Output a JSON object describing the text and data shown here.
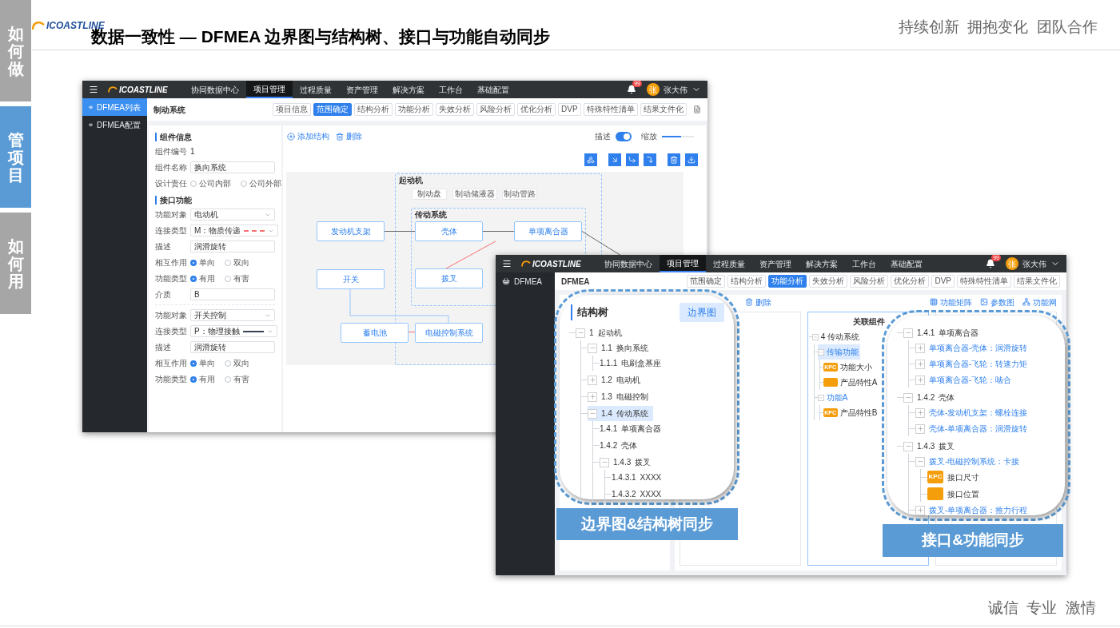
{
  "slide": {
    "side_tabs": [
      {
        "label": "如何做",
        "selected": false
      },
      {
        "label": "管项目",
        "selected": true
      },
      {
        "label": "如何用",
        "selected": false
      }
    ],
    "logo": "ICOASTLINE",
    "title": "数据一致性 — DFMEA 边界图与结构树、接口与功能自动同步",
    "motto": "持续创新  拥抱变化  团队合作",
    "footer_motto": "诚信  专业  激情"
  },
  "window_1": {
    "nav": {
      "logo": "ICOASTLINE",
      "items": [
        {
          "label": "协同数据中心",
          "selected": false
        },
        {
          "label": "项目管理",
          "selected": true
        },
        {
          "label": "过程质量",
          "selected": false
        },
        {
          "label": "资产管理",
          "selected": false
        },
        {
          "label": "解决方案",
          "selected": false
        },
        {
          "label": "工作台",
          "selected": false
        },
        {
          "label": "基础配置",
          "selected": false
        }
      ],
      "badge": "99",
      "avatar": "张",
      "user": "张大伟"
    },
    "sidebar": [
      {
        "label": "DFMEA列表",
        "selected": true
      },
      {
        "label": "DFMEA配置",
        "selected": false
      }
    ],
    "page_title": "制动系统",
    "tabs": [
      {
        "label": "项目信息",
        "selected": false
      },
      {
        "label": "范围确定",
        "selected": true
      },
      {
        "label": "结构分析",
        "selected": false
      },
      {
        "label": "功能分析",
        "selected": false
      },
      {
        "label": "失效分析",
        "selected": false
      },
      {
        "label": "风险分析",
        "selected": false
      },
      {
        "label": "优化分析",
        "selected": false
      },
      {
        "label": "DVP",
        "selected": false
      },
      {
        "label": "特殊特性清单",
        "selected": false
      },
      {
        "label": "结果文件化",
        "selected": false
      }
    ],
    "form": [
      {
        "kind": "section",
        "label": "组件信息"
      },
      {
        "kind": "text",
        "label": "组件编号",
        "value": "1"
      },
      {
        "kind": "input",
        "label": "组件名称",
        "value": "换向系统"
      },
      {
        "kind": "radio",
        "label": "设计责任",
        "options": [
          {
            "label": "公司内部",
            "selected": false
          },
          {
            "label": "公司外部",
            "selected": false
          }
        ]
      },
      {
        "kind": "section",
        "label": "接口功能"
      },
      {
        "kind": "select",
        "label": "功能对象",
        "value": "电动机"
      },
      {
        "kind": "select",
        "label": "连接类型",
        "value": "M：物质传递",
        "dashed": true,
        "color": "#f87171"
      },
      {
        "kind": "input",
        "label": "描述",
        "value": "润滑旋转"
      },
      {
        "kind": "radio",
        "label": "相互作用",
        "options": [
          {
            "label": "单向",
            "selected": true
          },
          {
            "label": "双向",
            "selected": false
          }
        ]
      },
      {
        "kind": "radio",
        "label": "功能类型",
        "options": [
          {
            "label": "有用",
            "selected": true
          },
          {
            "label": "有害",
            "selected": false
          }
        ]
      },
      {
        "kind": "input",
        "label": "介质",
        "value": "B"
      },
      {
        "kind": "divider"
      },
      {
        "kind": "select",
        "label": "功能对象",
        "value": "开关控制"
      },
      {
        "kind": "select",
        "label": "连接类型",
        "value": "P：物理接触",
        "dashed": false,
        "color": "#374151"
      },
      {
        "kind": "input",
        "label": "描述",
        "value": "润滑旋转"
      },
      {
        "kind": "radio",
        "label": "相互作用",
        "options": [
          {
            "label": "单向",
            "selected": true
          },
          {
            "label": "双向",
            "selected": false
          }
        ]
      },
      {
        "kind": "radio",
        "label": "功能类型",
        "options": [
          {
            "label": "有用",
            "selected": true
          },
          {
            "label": "有害",
            "selected": false
          }
        ]
      }
    ],
    "actions": [
      {
        "kind": "add",
        "label": "添加结构"
      },
      {
        "kind": "delete",
        "label": "删除"
      }
    ],
    "toggle": {
      "label": "描述",
      "on": true
    },
    "zoom": {
      "label": "缩放",
      "level": 0.6
    },
    "canvas": {
      "groups": [
        {
          "label": "起动机"
        },
        {
          "label": "传动系统"
        }
      ],
      "nodes": [
        {
          "kind": "part",
          "label": "制动盘"
        },
        {
          "kind": "part",
          "label": "制动储液器"
        },
        {
          "kind": "part",
          "label": "制动管路"
        },
        {
          "kind": "block",
          "label": "发动机支架"
        },
        {
          "kind": "block",
          "label": "壳体"
        },
        {
          "kind": "block",
          "label": "单项离合器"
        },
        {
          "kind": "block",
          "label": "开关"
        },
        {
          "kind": "block",
          "label": "拨叉"
        },
        {
          "kind": "block",
          "label": "蓄电池"
        },
        {
          "kind": "block",
          "label": "电磁控制系统"
        }
      ]
    }
  },
  "window_2": {
    "nav": {
      "logo": "ICOASTLINE",
      "items": [
        {
          "label": "协同数据中心",
          "selected": false
        },
        {
          "label": "项目管理",
          "selected": true
        },
        {
          "label": "过程质量",
          "selected": false
        },
        {
          "label": "资产管理",
          "selected": false
        },
        {
          "label": "解决方案",
          "selected": false
        },
        {
          "label": "工作台",
          "selected": false
        },
        {
          "label": "基础配置",
          "selected": false
        }
      ],
      "badge": "99",
      "avatar": "张",
      "user": "张大伟"
    },
    "sidebar": [
      {
        "label": "DFMEA",
        "selected": false
      }
    ],
    "page_title": "DFMEA",
    "tabs": [
      {
        "label": "范围确定",
        "selected": false
      },
      {
        "label": "结构分析",
        "selected": false
      },
      {
        "label": "功能分析",
        "selected": true
      },
      {
        "label": "失效分析",
        "selected": false
      },
      {
        "label": "风险分析",
        "selected": false
      },
      {
        "label": "优化分析",
        "selected": false
      },
      {
        "label": "DVP",
        "selected": false
      },
      {
        "label": "特殊特性清单",
        "selected": false
      },
      {
        "label": "结果文件化",
        "selected": false
      }
    ],
    "actions": [
      {
        "kind": "delete",
        "label": "删除"
      }
    ],
    "links": [
      {
        "kind": "matrix",
        "label": "功能矩阵"
      },
      {
        "kind": "diagram",
        "label": "参数图"
      },
      {
        "kind": "network",
        "label": "功能网"
      }
    ],
    "related": {
      "title": "关联组件",
      "tree": [
        {
          "kind": "group",
          "label": "4 传动系统",
          "expanded": true,
          "selected": false,
          "children": [
            {
              "kind": "function",
              "label": "传输功能",
              "expanded": true,
              "selected": true,
              "children": [
                {
                  "kind": "characteristic",
                  "badge": "KPC",
                  "label": "功能大小",
                  "selected": false
                },
                {
                  "kind": "characteristic",
                  "label": "产品特性A",
                  "selected": false
                }
              ]
            },
            {
              "kind": "function",
              "label": "功能A",
              "expanded": true,
              "selected": false,
              "children": [
                {
                  "kind": "characteristic",
                  "badge": "KPC",
                  "label": "产品特性B",
                  "selected": false
                }
              ]
            }
          ]
        }
      ]
    }
  },
  "callouts": [
    {
      "kind": "structure",
      "title": "结构树",
      "button": "边界图",
      "caption": "边界图&结构树同步",
      "tree": [
        {
          "kind": "group",
          "number": "1",
          "label": "起动机",
          "expanded": true,
          "selected": false,
          "children": [
            {
              "kind": "group",
              "number": "1.1",
              "label": "换向系统",
              "expanded": true,
              "selected": false,
              "children": [
                {
                  "kind": "group",
                  "number": "1.1.1",
                  "label": "电刷盒基座",
                  "selected": false
                }
              ]
            },
            {
              "kind": "group",
              "number": "1.2",
              "label": "电动机",
              "expanded": false,
              "selected": false
            },
            {
              "kind": "group",
              "number": "1.3",
              "label": "电磁控制",
              "expanded": false,
              "selected": false
            },
            {
              "kind": "group",
              "number": "1.4",
              "label": "传动系统",
              "expanded": true,
              "selected": true,
              "children": [
                {
                  "kind": "group",
                  "number": "1.4.1",
                  "label": "单项离合器",
                  "selected": false
                },
                {
                  "kind": "group",
                  "number": "1.4.2",
                  "label": "壳体",
                  "selected": false
                },
                {
                  "kind": "group",
                  "number": "1.4.3",
                  "label": "拨叉",
                  "expanded": true,
                  "selected": false,
                  "children": [
                    {
                      "kind": "group",
                      "number": "1.4.3.1",
                      "label": "XXXX",
                      "selected": false
                    },
                    {
                      "kind": "group",
                      "number": "1.4.3.2",
                      "label": "XXXX",
                      "selected": false
                    }
                  ]
                }
              ]
            }
          ]
        }
      ]
    },
    {
      "kind": "interface",
      "caption": "接口&功能同步",
      "tree": [
        {
          "kind": "group",
          "number": "1.4.1",
          "label": "单项离合器",
          "expanded": true,
          "children": [
            {
              "kind": "function",
              "label": "单项离合器-壳体：润滑旋转",
              "expanded": false
            },
            {
              "kind": "function",
              "label": "单项离合器-飞轮：转速力矩",
              "expanded": false
            },
            {
              "kind": "function",
              "label": "单项离合器-飞轮：啮合",
              "expanded": false
            }
          ]
        },
        {
          "kind": "group",
          "number": "1.4.2",
          "label": "壳体",
          "expanded": true,
          "children": [
            {
              "kind": "function",
              "label": "壳体-发动机支架：螺栓连接",
              "expanded": false
            },
            {
              "kind": "function",
              "label": "壳体-单项离合器：润滑旋转",
              "expanded": false
            }
          ]
        },
        {
          "kind": "group",
          "number": "1.4.3",
          "label": "拨叉",
          "expanded": true,
          "children": [
            {
              "kind": "function",
              "label": "拨叉-电磁控制系统：卡接",
              "expanded": true,
              "children": [
                {
                  "kind": "characteristic",
                  "badge": "KPC",
                  "label": "接口尺寸"
                },
                {
                  "kind": "characteristic",
                  "label": "接口位置"
                }
              ]
            },
            {
              "kind": "function",
              "label": "拨叉-单项离合器：推力行程",
              "expanded": false
            }
          ]
        }
      ]
    }
  ]
}
